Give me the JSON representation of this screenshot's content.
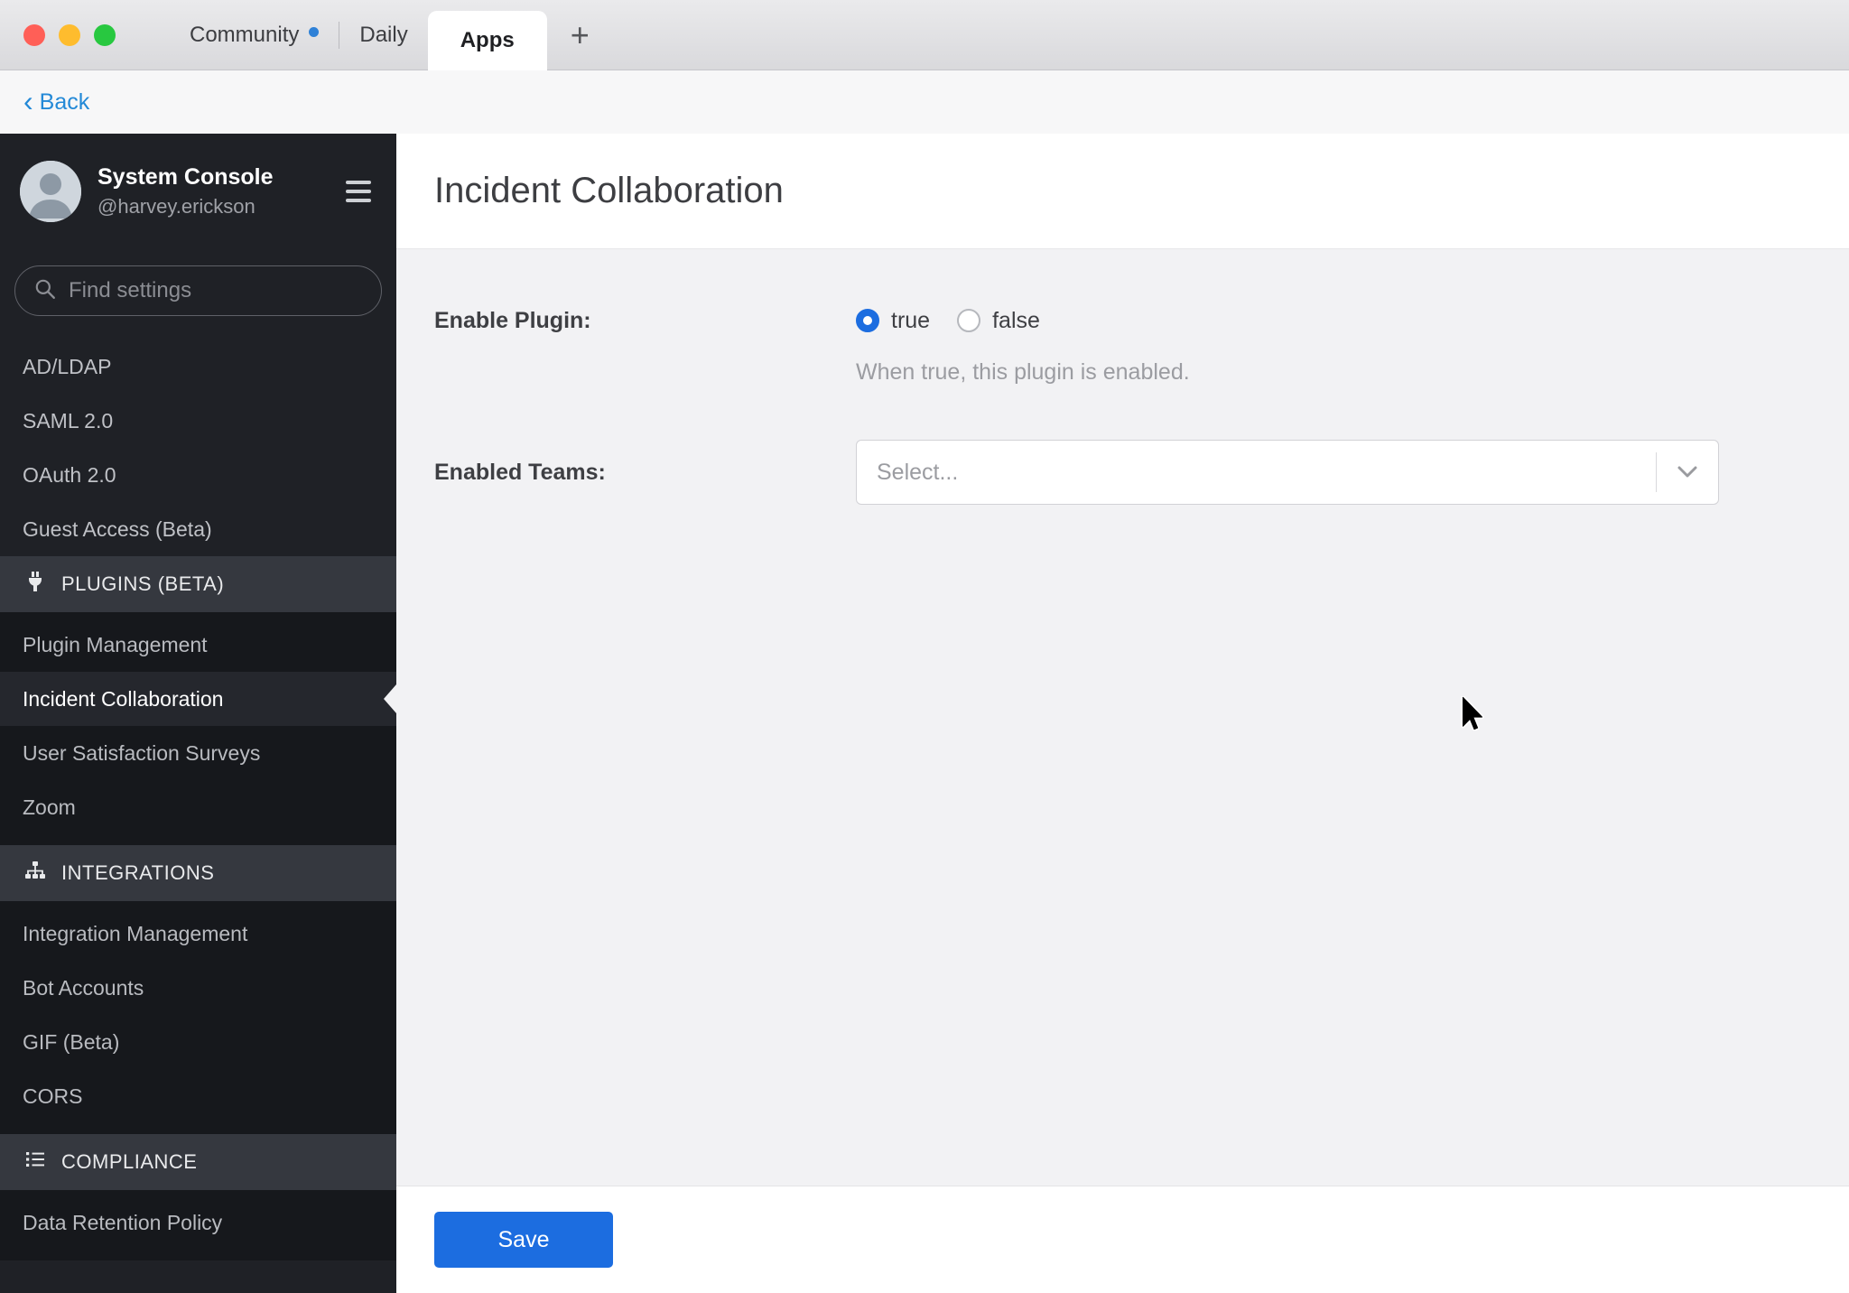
{
  "window": {
    "tabs": [
      {
        "label": "Community",
        "has_unread_dot": true
      },
      {
        "label": "Daily"
      },
      {
        "label": "Apps",
        "active": true
      }
    ],
    "new_tab": "+"
  },
  "back": {
    "chevron": "‹",
    "label": "Back"
  },
  "sidebar": {
    "profile": {
      "title": "System Console",
      "username": "@harvey.erickson"
    },
    "search": {
      "placeholder": "Find settings"
    },
    "top_items": [
      "AD/LDAP",
      "SAML 2.0",
      "OAuth 2.0",
      "Guest Access (Beta)"
    ],
    "sections": [
      {
        "label": "PLUGINS (BETA)",
        "icon": "plug-icon",
        "items": [
          "Plugin Management",
          "Incident Collaboration",
          "User Satisfaction Surveys",
          "Zoom"
        ],
        "selected_item": "Incident Collaboration"
      },
      {
        "label": "INTEGRATIONS",
        "icon": "sitemap-icon",
        "items": [
          "Integration Management",
          "Bot Accounts",
          "GIF (Beta)",
          "CORS"
        ]
      },
      {
        "label": "COMPLIANCE",
        "icon": "list-icon",
        "items": [
          "Data Retention Policy"
        ]
      }
    ]
  },
  "main": {
    "title": "Incident Collaboration",
    "enable_plugin": {
      "label": "Enable Plugin:",
      "options": [
        {
          "label": "true",
          "selected": true
        },
        {
          "label": "false",
          "selected": false
        }
      ],
      "help": "When true, this plugin is enabled."
    },
    "enabled_teams": {
      "label": "Enabled Teams:",
      "placeholder": "Select..."
    },
    "save_label": "Save"
  },
  "colors": {
    "accent_blue": "#1c6de0",
    "link_blue": "#2389d7",
    "unread_dot_blue": "#2f81d7",
    "sidebar_bg": "#1f2126",
    "sidebar_group_bg": "#16181c",
    "section_header_bg": "#35383f",
    "content_bg": "#f2f2f4",
    "traffic_red": "#ff5f57",
    "traffic_yellow": "#febc2e",
    "traffic_green": "#28c840"
  }
}
